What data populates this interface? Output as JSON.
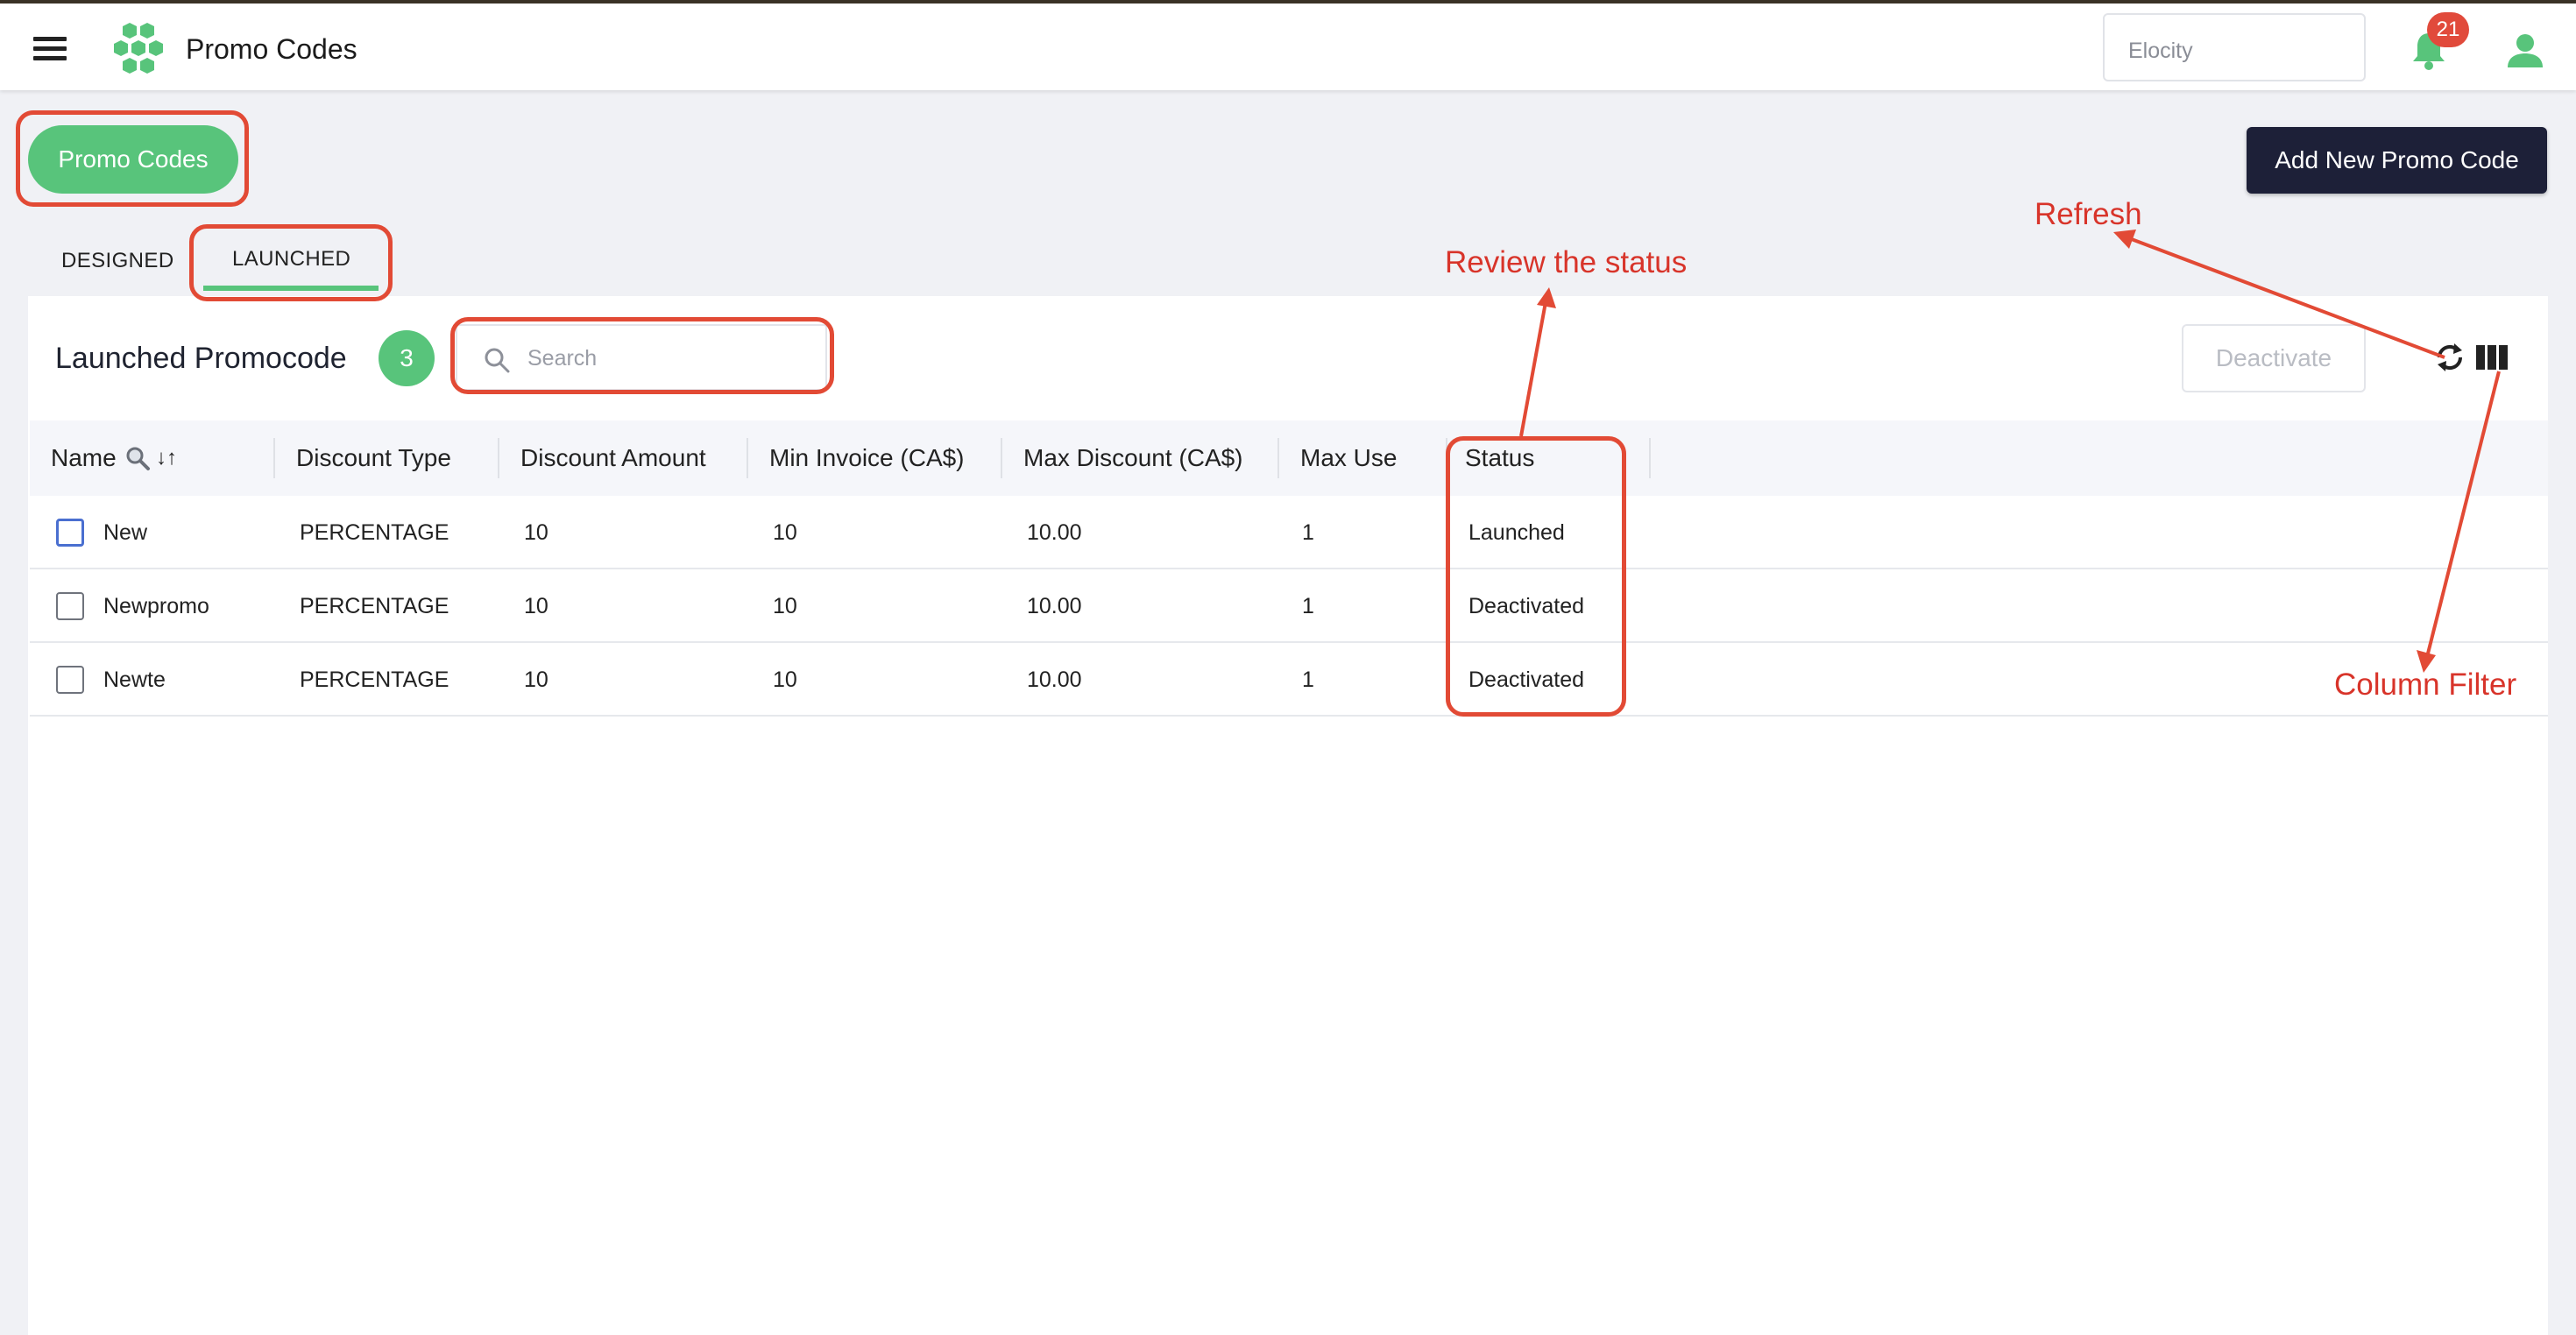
{
  "header": {
    "title": "Promo Codes",
    "org_select_value": "Elocity",
    "notification_count": "21"
  },
  "page": {
    "breadcrumb_pill": "Promo Codes",
    "add_button": "Add New Promo Code"
  },
  "tabs": [
    {
      "label": "DESIGNED",
      "active": false
    },
    {
      "label": "LAUNCHED",
      "active": true
    }
  ],
  "card": {
    "title": "Launched Promocode",
    "count": "3",
    "search_placeholder": "Search",
    "deactivate_label": "Deactivate"
  },
  "table": {
    "columns": [
      "Name",
      "Discount Type",
      "Discount Amount",
      "Min Invoice (CA$)",
      "Max Discount (CA$)",
      "Max Use",
      "Status"
    ],
    "sort_symbol": "↓↑",
    "rows": [
      {
        "name": "New",
        "discount_type": "PERCENTAGE",
        "discount_amount": "10",
        "min_invoice": "10",
        "max_discount": "10.00",
        "max_use": "1",
        "status": "Launched"
      },
      {
        "name": "Newpromo",
        "discount_type": "PERCENTAGE",
        "discount_amount": "10",
        "min_invoice": "10",
        "max_discount": "10.00",
        "max_use": "1",
        "status": "Deactivated"
      },
      {
        "name": "Newte",
        "discount_type": "PERCENTAGE",
        "discount_amount": "10",
        "min_invoice": "10",
        "max_discount": "10.00",
        "max_use": "1",
        "status": "Deactivated"
      }
    ]
  },
  "annotations": {
    "review_status": "Review the status",
    "refresh": "Refresh",
    "column_filter": "Column Filter"
  },
  "colors": {
    "brand_green": "#58c47b",
    "navy": "#1d2038",
    "annotation_red": "#e24a35"
  }
}
